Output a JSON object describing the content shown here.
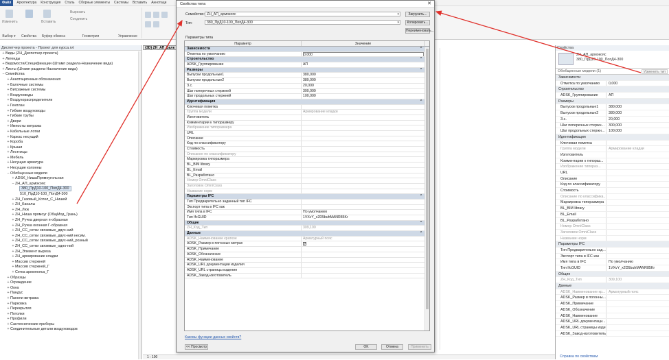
{
  "menubar": {
    "file": "Файл",
    "tabs": [
      "Архитектура",
      "Конструкция",
      "Сталь",
      "Сборные элементы",
      "Системы",
      "Вставить",
      "Аннотаци"
    ]
  },
  "ribbon": {
    "groups": [
      {
        "label": "Выбор ▾",
        "buttons": [
          "Изменить"
        ]
      },
      {
        "label": "Свойства",
        "buttons": [
          "Свойства"
        ]
      },
      {
        "label": "Буфер обмена",
        "buttons": [
          "Вставить"
        ]
      },
      {
        "label": "Геометрия",
        "buttons": [
          "Вырезать",
          "Соединить"
        ]
      },
      {
        "label": "Управление",
        "buttons": []
      }
    ]
  },
  "project_browser": {
    "title": "Диспетчер проекта - Проект для курса.rvt",
    "items": [
      {
        "t": "Виды (ZH_Диспетчер проекта)",
        "lvl": 0,
        "ex": "+"
      },
      {
        "t": "Легенды",
        "lvl": 0,
        "ex": "+"
      },
      {
        "t": "Ведомости/Спецификации (Штамп раздела-Назначение вида)",
        "lvl": 0,
        "ex": "+"
      },
      {
        "t": "Листы (Штамп раздела-Назначение вида)",
        "lvl": 0,
        "ex": "+"
      },
      {
        "t": "Семейства",
        "lvl": 0,
        "ex": "−"
      },
      {
        "t": "Аннотационные обозначения",
        "lvl": 1,
        "ex": "+"
      },
      {
        "t": "Балочные системы",
        "lvl": 1,
        "ex": "+"
      },
      {
        "t": "Витражные системы",
        "lvl": 1,
        "ex": "+"
      },
      {
        "t": "Воздуховоды",
        "lvl": 1,
        "ex": "+"
      },
      {
        "t": "Воздухораспределители",
        "lvl": 1,
        "ex": "+"
      },
      {
        "t": "Генплан",
        "lvl": 1,
        "ex": "+"
      },
      {
        "t": "Гибкие воздуховоды",
        "lvl": 1,
        "ex": "+"
      },
      {
        "t": "Гибкие трубы",
        "lvl": 1,
        "ex": "+"
      },
      {
        "t": "Двери",
        "lvl": 1,
        "ex": "+"
      },
      {
        "t": "Импосты витража",
        "lvl": 1,
        "ex": "+"
      },
      {
        "t": "Кабельные лотки",
        "lvl": 1,
        "ex": "+"
      },
      {
        "t": "Каркас несущий",
        "lvl": 1,
        "ex": "+"
      },
      {
        "t": "Короба",
        "lvl": 1,
        "ex": "+"
      },
      {
        "t": "Крыши",
        "lvl": 1,
        "ex": "+"
      },
      {
        "t": "Лестницы",
        "lvl": 1,
        "ex": "+"
      },
      {
        "t": "Мебель",
        "lvl": 1,
        "ex": "+"
      },
      {
        "t": "Несущая арматура",
        "lvl": 1,
        "ex": "+"
      },
      {
        "t": "Несущие колонны",
        "lvl": 1,
        "ex": "+"
      },
      {
        "t": "Обобщенные модели",
        "lvl": 1,
        "ex": "−"
      },
      {
        "t": "ADSK_НишаПрямоугольная",
        "lvl": 2,
        "ex": "+"
      },
      {
        "t": "ZH_АП_армокояс",
        "lvl": 2,
        "ex": "−"
      },
      {
        "t": "380_ПрД10-100_ПопД4-300",
        "lvl": 3,
        "ex": "",
        "sel": true
      },
      {
        "t": "510_ПрД10-100_ПопД4-300",
        "lvl": 3,
        "ex": ""
      },
      {
        "t": "ZH_Газовый_Котел_С_Нишей",
        "lvl": 2,
        "ex": "+"
      },
      {
        "t": "ZH_Каналы",
        "lvl": 2,
        "ex": "+"
      },
      {
        "t": "ZH_Люк",
        "lvl": 2,
        "ex": "+"
      },
      {
        "t": "ZH_Ниша прямоуг (ОбщМод_Грань)",
        "lvl": 2,
        "ex": "+"
      },
      {
        "t": "ZH_Ручка дверная п-образная",
        "lvl": 2,
        "ex": "+"
      },
      {
        "t": "ZH_Ручка оконная Г-образная",
        "lvl": 2,
        "ex": "+"
      },
      {
        "t": "ZH_СС_сетки связевые_двух-ний",
        "lvl": 2,
        "ex": "+"
      },
      {
        "t": "ZH_СС_сетки связевые_двух-ний несим.",
        "lvl": 2,
        "ex": "+"
      },
      {
        "t": "ZH_СС_сетки связевые_двух-ний_розный",
        "lvl": 2,
        "ex": "+"
      },
      {
        "t": "ZH_СС_сетки связевые_одно-ний",
        "lvl": 2,
        "ex": "+"
      },
      {
        "t": "ZH_Элемент выреза",
        "lvl": 2,
        "ex": "+"
      },
      {
        "t": "ZH_армирование кладки",
        "lvl": 2,
        "ex": "+"
      },
      {
        "t": "Массив стержней",
        "lvl": 2,
        "ex": "+"
      },
      {
        "t": "Массив стержней_Г",
        "lvl": 2,
        "ex": "+"
      },
      {
        "t": "Сетка армопояса_Г",
        "lvl": 2,
        "ex": "+"
      },
      {
        "t": "Образцы",
        "lvl": 1,
        "ex": "+"
      },
      {
        "t": "Ограждение",
        "lvl": 1,
        "ex": "+"
      },
      {
        "t": "Окна",
        "lvl": 1,
        "ex": "+"
      },
      {
        "t": "Пандус",
        "lvl": 1,
        "ex": "+"
      },
      {
        "t": "Панели витража",
        "lvl": 1,
        "ex": "+"
      },
      {
        "t": "Парковка",
        "lvl": 1,
        "ex": "+"
      },
      {
        "t": "Перекрытия",
        "lvl": 1,
        "ex": "+"
      },
      {
        "t": "Потолки",
        "lvl": 1,
        "ex": "+"
      },
      {
        "t": "Профили",
        "lvl": 1,
        "ex": "+"
      },
      {
        "t": "Сантехнические приборы",
        "lvl": 1,
        "ex": "+"
      },
      {
        "t": "Соединительные детали воздуховодов",
        "lvl": 1,
        "ex": "+"
      }
    ]
  },
  "view": {
    "tab_label": "{3D} ZH_АП_Балк",
    "scale": "1 : 100"
  },
  "dialog": {
    "title": "Свойства типа",
    "family_label": "Семейство:",
    "family_value": "ZH_АП_армокояс",
    "type_label": "Тип:",
    "type_value": "380_ПрД10-100_ПопД4-300",
    "load_button": "Загрузить...",
    "duplicate_button": "Копировать...",
    "rename_button": "Переименовать...",
    "params_label": "Параметры типа",
    "col_param": "Параметр",
    "col_value": "Значение",
    "rows": [
      {
        "h": "Зависимости"
      },
      {
        "k": "Отметка по умолчанию",
        "v": "0,000",
        "inp": true
      },
      {
        "h": "Строительство"
      },
      {
        "k": "ADSK_Группирование",
        "v": "АП"
      },
      {
        "h": "Размеры"
      },
      {
        "k": "Выпуски продольные1",
        "v": "380,000"
      },
      {
        "k": "Выпуски продольные2",
        "v": "380,000"
      },
      {
        "k": "З.с.",
        "v": "20,000"
      },
      {
        "k": "Шаг поперечных стержней",
        "v": "300,000"
      },
      {
        "k": "Шаг продольных стержней",
        "v": "100,000"
      },
      {
        "h": "Идентификация"
      },
      {
        "k": "Ключевая пометка",
        "v": ""
      },
      {
        "k": "Группа модели",
        "v": "Армирование кладки",
        "dim": true
      },
      {
        "k": "Изготовитель",
        "v": ""
      },
      {
        "k": "Комментарии к типоразмеру",
        "v": ""
      },
      {
        "k": "Изображение типоразмера",
        "v": "",
        "dim": true
      },
      {
        "k": "URL",
        "v": ""
      },
      {
        "k": "Описание",
        "v": ""
      },
      {
        "k": "Код по классификатору",
        "v": ""
      },
      {
        "k": "Стоимость",
        "v": ""
      },
      {
        "k": "Описание по классификатору",
        "v": "",
        "dim": true
      },
      {
        "k": "Маркировка типоразмера",
        "v": ""
      },
      {
        "k": "BL_BIM library",
        "v": ""
      },
      {
        "k": "BL_Email",
        "v": ""
      },
      {
        "k": "BL_Разработано",
        "v": ""
      },
      {
        "k": "Номер OmniClass",
        "v": "",
        "dim": true
      },
      {
        "k": "Заголовок OmniClass",
        "v": "",
        "dim": true
      },
      {
        "k": "Название норм",
        "v": "",
        "dim": true
      },
      {
        "h": "Параметры IFC"
      },
      {
        "k": "Тип Предварительно заданный тип IFC",
        "v": ""
      },
      {
        "k": "Экспорт типа в IFC как",
        "v": ""
      },
      {
        "k": "Имя типа в IFC",
        "v": "По умолчанию"
      },
      {
        "k": "Тип IfcGUID",
        "v": "1VXvY_x2D5buhMANR85Kr"
      },
      {
        "h": "Общие"
      },
      {
        "k": "ZH_Код_Тип",
        "v": "309,100",
        "dim": true
      },
      {
        "h": "Данные"
      },
      {
        "k": "ADSK_Наименование краткое",
        "v": "Арматурный пояс",
        "dim": true
      },
      {
        "k": "ADSK_Размер в погонных метрах",
        "v": "✓",
        "chk": true
      },
      {
        "k": "ADSK_Примечание",
        "v": ""
      },
      {
        "k": "ADSK_Обозначение",
        "v": ""
      },
      {
        "k": "ADSK_Наименование",
        "v": ""
      },
      {
        "k": "ADSK_URL документации изделия",
        "v": ""
      },
      {
        "k": "ADSK_URL страницы изделия",
        "v": ""
      },
      {
        "k": "ADSK_Завод-изготовитель",
        "v": ""
      }
    ],
    "help_link": "Каковы функции данных свойств?",
    "preview_button": "<< Просмотр",
    "ok_button": "OK",
    "cancel_button": "Отмена",
    "apply_button": "Применить"
  },
  "properties": {
    "title": "Свойства",
    "type_line1": "ZH_АП_армокояс",
    "type_line2": "380_ПрД10-100_ПопД4-300",
    "filter": "Обобщенные модели (1)",
    "edit_type": "Изменить тип",
    "rows": [
      {
        "h": "Зависимости"
      },
      {
        "k": "Отметка по умолчанию",
        "v": "0,000"
      },
      {
        "h": "Строительство"
      },
      {
        "k": "ADSK_Группирование",
        "v": "АП"
      },
      {
        "h": "Размеры"
      },
      {
        "k": "Выпуски продольные1",
        "v": "380,000"
      },
      {
        "k": "Выпуски продольные2",
        "v": "380,000"
      },
      {
        "k": "З.с.",
        "v": "20,000"
      },
      {
        "k": "Шаг поперечных стержн...",
        "v": "300,000"
      },
      {
        "k": "Шаг продольных стержн...",
        "v": "100,000"
      },
      {
        "h": "Идентификация"
      },
      {
        "k": "Ключевая пометка",
        "v": ""
      },
      {
        "k": "Группа модели",
        "v": "Армирование кладки",
        "dim": true
      },
      {
        "k": "Изготовитель",
        "v": ""
      },
      {
        "k": "Комментарии к типораз...",
        "v": ""
      },
      {
        "k": "Изображение типораз...",
        "v": "",
        "dim": true
      },
      {
        "k": "URL",
        "v": ""
      },
      {
        "k": "Описание",
        "v": ""
      },
      {
        "k": "Код по классификатору",
        "v": ""
      },
      {
        "k": "Стоимость",
        "v": ""
      },
      {
        "k": "Описание по классифика...",
        "v": "",
        "dim": true
      },
      {
        "k": "Маркировка типоразмера",
        "v": ""
      },
      {
        "k": "BL_BIM library",
        "v": ""
      },
      {
        "k": "BL_Email",
        "v": ""
      },
      {
        "k": "BL_Разработано",
        "v": ""
      },
      {
        "k": "Номер OmniClass",
        "v": "",
        "dim": true
      },
      {
        "k": "Заголовок OmniClass",
        "v": "",
        "dim": true
      },
      {
        "k": "Название норм",
        "v": "",
        "dim": true
      },
      {
        "h": "Параметры IFC"
      },
      {
        "k": "Тип Предварительно зад...",
        "v": ""
      },
      {
        "k": "Экспорт типа в IFC как",
        "v": ""
      },
      {
        "k": "Имя типа в IFC",
        "v": "По умолчанию"
      },
      {
        "k": "Тип IfcGUID",
        "v": "1VXvY_x2D5buhMANR85Kr"
      },
      {
        "h": "Общие"
      },
      {
        "k": "ZH_Код_Тип",
        "v": "309,100",
        "dim": true
      },
      {
        "h": "Данные"
      },
      {
        "k": "ADSK_Наименование кр...",
        "v": "Арматурный пояс",
        "dim": true
      },
      {
        "k": "ADSK_Размер в погонны...",
        "v": ""
      },
      {
        "k": "ADSK_Примечание",
        "v": ""
      },
      {
        "k": "ADSK_Обозначение",
        "v": ""
      },
      {
        "k": "ADSK_Наименование",
        "v": ""
      },
      {
        "k": "ADSK_URL документаци...",
        "v": ""
      },
      {
        "k": "ADSK_URL страницы изде...",
        "v": ""
      },
      {
        "k": "ADSK_Завод-изготовитель",
        "v": ""
      }
    ],
    "help_link": "Справка по свойствам"
  },
  "annotation_color": "#e0302a"
}
